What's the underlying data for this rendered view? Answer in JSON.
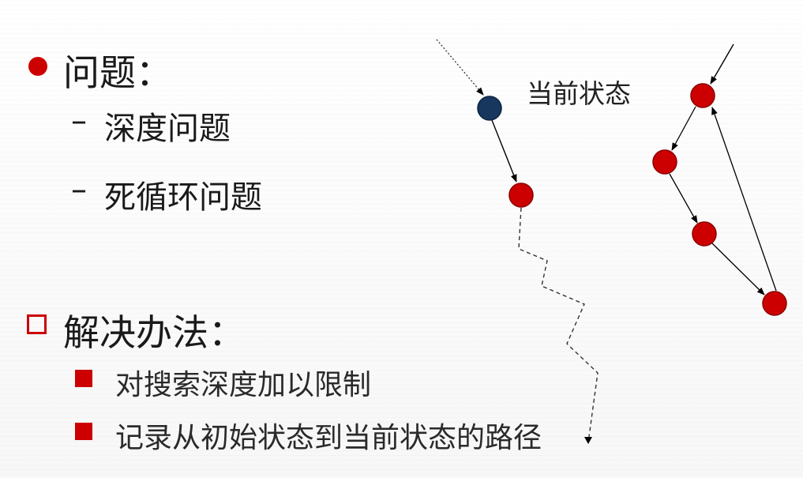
{
  "problem": {
    "title": "问题：",
    "items": [
      "深度问题",
      "死循环问题"
    ],
    "dash": "–"
  },
  "solution": {
    "title": "解决办法：",
    "items": [
      "对搜索深度加以限制",
      "记录从初始状态到当前状态的路径"
    ]
  },
  "diagram": {
    "current_state_label": "当前状态"
  },
  "colors": {
    "accent": "#cc0000",
    "node_red": "#cc0000",
    "node_blue": "#17375e",
    "text": "#1a1a1a"
  }
}
